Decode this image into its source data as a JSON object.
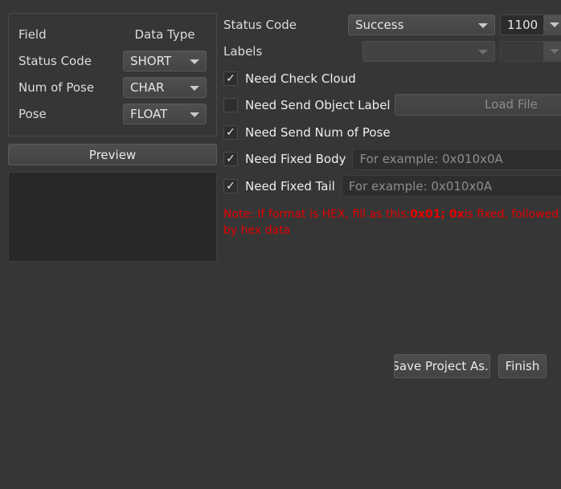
{
  "left_panel": {
    "header": {
      "field": "Field",
      "data_type": "Data Type"
    },
    "rows": [
      {
        "label": "Status Code",
        "type_value": "SHORT"
      },
      {
        "label": "Num of Pose",
        "type_value": "CHAR"
      },
      {
        "label": "Pose",
        "type_value": "FLOAT"
      }
    ],
    "preview_button": "Preview",
    "preview_output": ""
  },
  "right_panel": {
    "status_code": {
      "label": "Status Code",
      "combo_value": "Success",
      "code_value": "1100"
    },
    "labels": {
      "label": "Labels",
      "combo_value": "",
      "code_value": ""
    },
    "check_cloud": {
      "label": "Need Check Cloud",
      "checked": "✓"
    },
    "send_object_label": {
      "label": "Need Send Object Label",
      "checked": "",
      "button": "Load File"
    },
    "send_num_of_pose": {
      "label": "Need Send Num of Pose",
      "checked": "✓"
    },
    "fixed_body": {
      "label": "Need Fixed Body",
      "checked": "✓",
      "placeholder": "For example: 0x010x0A",
      "value": ""
    },
    "fixed_tail": {
      "label": "Need Fixed Tail",
      "checked": "✓",
      "placeholder": "For example: 0x010x0A",
      "value": ""
    },
    "note": {
      "part1": "Note: If format is HEX, fill as this:",
      "part2": "0x01; 0x",
      "part3": "is fixed, followed by hex data"
    }
  },
  "footer": {
    "save_project_label": "Save Project As..",
    "finish_label": "Finish"
  },
  "colors": {
    "background": "#363636",
    "note_red": "#e60000",
    "text": "#dcdcdc"
  }
}
